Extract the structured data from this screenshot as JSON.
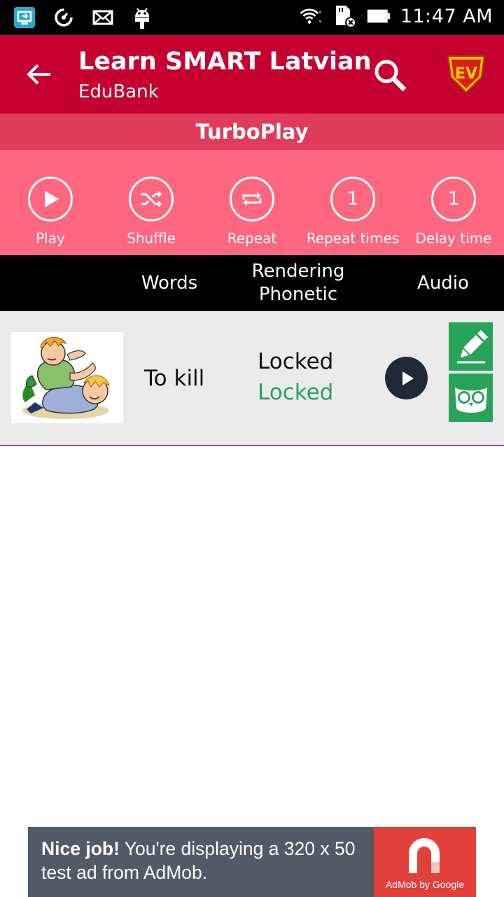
{
  "status_bar": {
    "time": "11:47 AM",
    "left_icons": [
      "screen-cast-icon",
      "speed-icon",
      "mail-icon",
      "android-icon"
    ],
    "right_icons": [
      "wifi-icon",
      "sd-card-icon",
      "battery-icon"
    ]
  },
  "app_bar": {
    "title": "Learn SMART Latvian",
    "subtitle": "EduBank",
    "back_icon": "arrow-left-icon",
    "search_icon": "search-icon",
    "logo": "ev-logo",
    "color": "#c60030"
  },
  "turbo": {
    "title": "TurboPlay",
    "color": "#df3b5b"
  },
  "controls": {
    "color": "#ff6680",
    "items": [
      {
        "label": "Play",
        "icon": "play-icon",
        "value": ""
      },
      {
        "label": "Shuffle",
        "icon": "shuffle-icon",
        "value": ""
      },
      {
        "label": "Repeat",
        "icon": "repeat-icon",
        "value": ""
      },
      {
        "label": "Repeat times",
        "icon": "",
        "value": "1"
      },
      {
        "label": "Delay time",
        "icon": "",
        "value": "1"
      }
    ]
  },
  "columns": {
    "words": "Words",
    "rendering": "Rendering",
    "phonetic": "Phonetic",
    "audio": "Audio"
  },
  "rows": [
    {
      "word": "To kill",
      "rendering": "Locked",
      "phonetic": "Locked",
      "image": "fighting-kids-image",
      "audio_icon": "play-circle-icon",
      "edit_icon": "pencil-icon",
      "view_icon": "owl-icon"
    }
  ],
  "ad": {
    "bold": "Nice job!",
    "text": " You're displaying a 320 x 50 test ad from AdMob.",
    "brand": "AdMob by Google",
    "color": "#515b68",
    "logo_color": "#e2403b"
  }
}
